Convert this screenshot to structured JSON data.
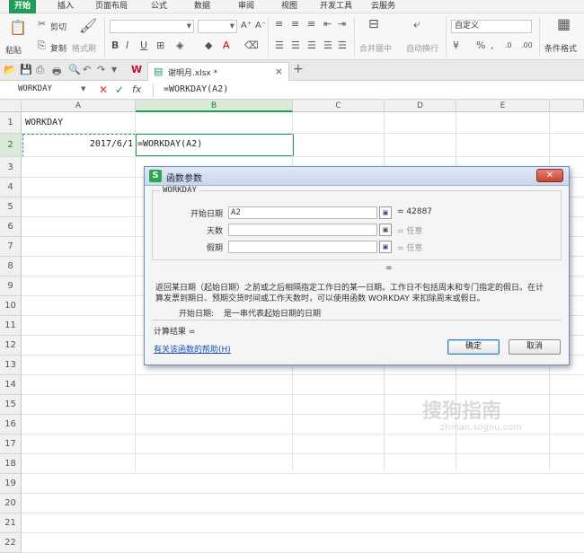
{
  "menu": {
    "tabs": [
      "开始",
      "插入",
      "页面布局",
      "公式",
      "数据",
      "审阅",
      "视图",
      "开发工具",
      "云服务"
    ]
  },
  "ribbon": {
    "paste": "粘贴",
    "cut": "剪切",
    "copy": "复制",
    "format_painter": "格式刷",
    "merge_center": "合并居中",
    "wrap_text": "自动换行",
    "number_format": "自定义",
    "cond_format": "条件格式"
  },
  "filetab": {
    "name": "谢明月.xlsx *"
  },
  "formula_bar": {
    "name_box": "WORKDAY",
    "content": "=WORKDAY(A2)"
  },
  "sheet": {
    "columns": [
      "A",
      "B",
      "C",
      "D",
      "E"
    ],
    "rows": [
      "1",
      "2",
      "3",
      "4",
      "5",
      "6",
      "7",
      "8",
      "9",
      "10",
      "11",
      "12",
      "13",
      "14",
      "15",
      "16",
      "17",
      "18",
      "19",
      "20",
      "21",
      "22"
    ],
    "a1": "WORKDAY",
    "a2": "2017/6/1",
    "b2": "=WORKDAY(A2)"
  },
  "dialog": {
    "title": "函数参数",
    "function_name": "WORKDAY",
    "args": [
      {
        "label": "开始日期",
        "value": "A2",
        "result": "= 42887"
      },
      {
        "label": "天数",
        "value": "",
        "result": "= 任意"
      },
      {
        "label": "假期",
        "value": "",
        "result": "= 任意"
      }
    ],
    "equals": "=",
    "description_1": "返回某日期（起始日期）之前或之后相隔指定工作日的某一日期。工作日不包括周末和专门指定的假日。在计",
    "description_2": "算发票到期日、预期交货时间或工作天数时，可以使用函数 WORKDAY 来扣除周末或假日。",
    "param_name": "开始日期:",
    "param_desc": "是一串代表起始日期的日期",
    "result_label": "计算结果 =",
    "help_link": "有关该函数的帮助(H)",
    "ok": "确定",
    "cancel": "取消"
  },
  "watermark": {
    "text": "搜狗指南",
    "sub": "zhinan.sogou.com"
  }
}
